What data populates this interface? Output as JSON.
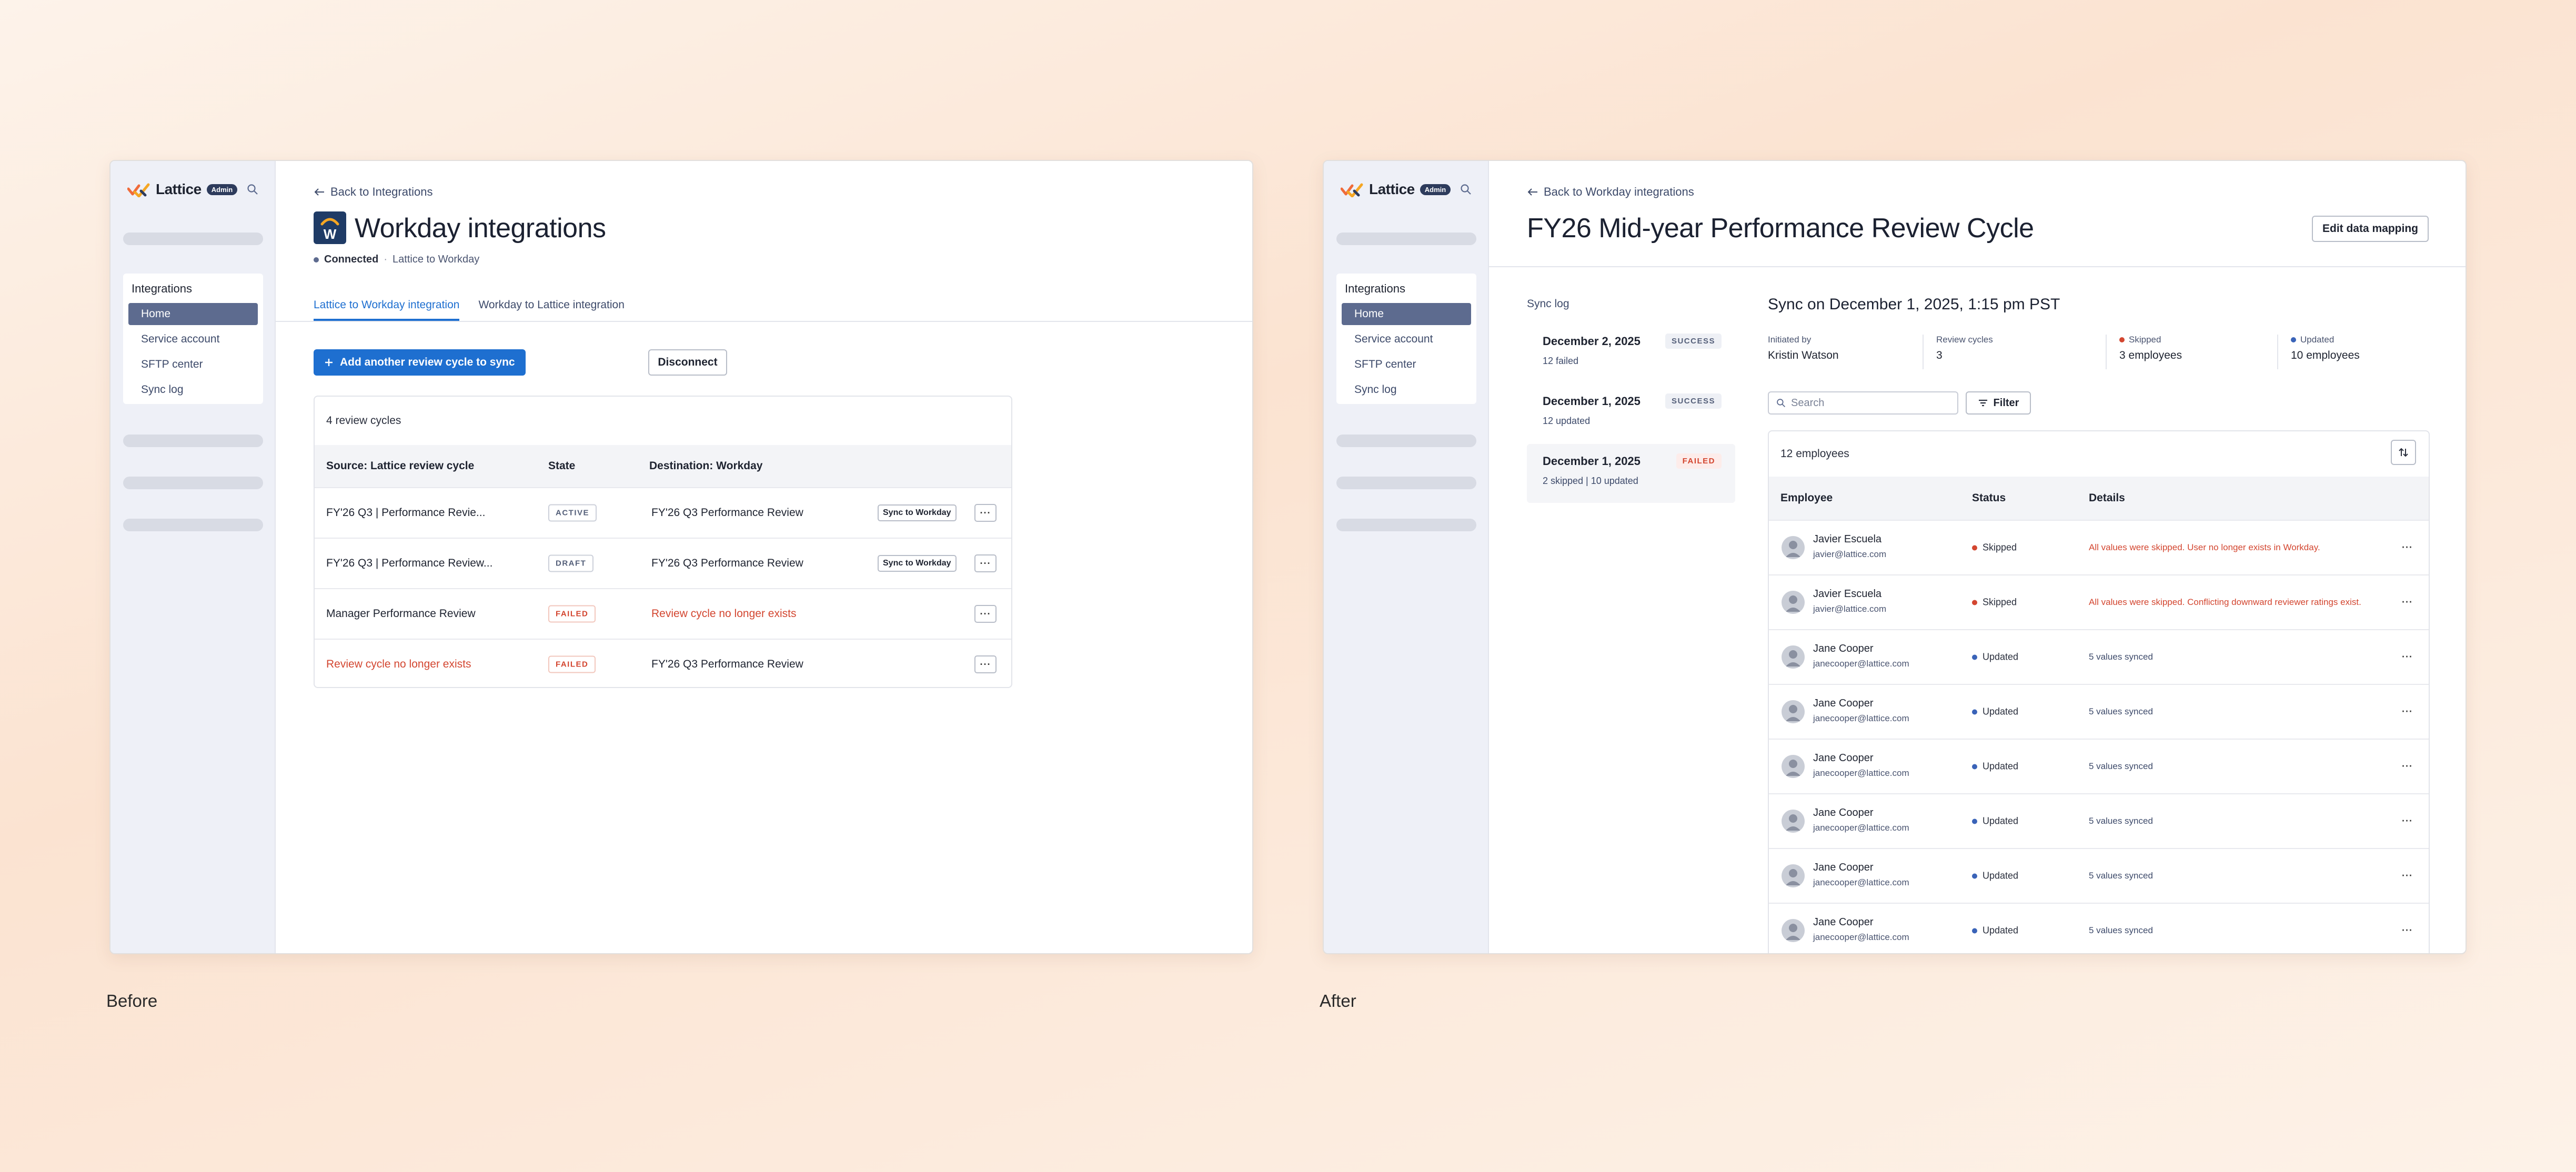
{
  "before": {
    "caption": "Before",
    "app": {
      "name": "Lattice",
      "badge": "Admin"
    },
    "nav": {
      "title": "Integrations",
      "items": [
        "Home",
        "Service account",
        "SFTP center",
        "Sync log"
      ]
    },
    "back_label": "Back to Integrations",
    "page_title": "Workday integrations",
    "status": {
      "label": "Connected",
      "sub": "Lattice to Workday"
    },
    "tabs": [
      "Lattice to Workday integration",
      "Workday to Lattice integration"
    ],
    "add_label": "Add another review cycle to sync",
    "disconnect_label": "Disconnect",
    "card_caption": "4 review cycles",
    "columns": [
      "Source: Lattice review cycle",
      "State",
      "Destination: Workday"
    ],
    "sync_label": "Sync to Workday",
    "rows": [
      {
        "source": "FY'26 Q3 | Performance Revie...",
        "state": "ACTIVE",
        "dest": "FY'26 Q3 Performance Review"
      },
      {
        "source": "FY'26 Q3 | Performance Review...",
        "state": "DRAFT",
        "dest": "FY'26 Q3 Performance Review"
      },
      {
        "source": "Manager Performance Review",
        "state": "FAILED",
        "dest": "Review cycle no longer exists"
      },
      {
        "source": "Review cycle no longer exists",
        "state": "FAILED",
        "dest": "FY'26 Q3 Performance Review"
      }
    ]
  },
  "after": {
    "caption": "After",
    "app": {
      "name": "Lattice",
      "badge": "Admin"
    },
    "nav": {
      "title": "Integrations",
      "items": [
        "Home",
        "Service account",
        "SFTP center",
        "Sync log"
      ]
    },
    "back_label": "Back to Workday integrations",
    "page_title": "FY26 Mid-year Performance Review Cycle",
    "edit_label": "Edit data mapping",
    "sync_log_title": "Sync log",
    "sync_log": [
      {
        "date": "December 2, 2025",
        "badge": "SUCCESS",
        "sub": "12 failed"
      },
      {
        "date": "December 1, 2025",
        "badge": "SUCCESS",
        "sub": "12 updated"
      },
      {
        "date": "December 1, 2025",
        "badge": "FAILED",
        "sub": "2 skipped | 10 updated"
      }
    ],
    "sync_title": "Sync on December 1, 2025, 1:15 pm PST",
    "stats": [
      {
        "label": "Initiated by",
        "value": "Kristin Watson"
      },
      {
        "label": "Review cycles",
        "value": "3"
      },
      {
        "label": "Skipped",
        "value": "3 employees"
      },
      {
        "label": "Updated",
        "value": "10 employees"
      }
    ],
    "search_placeholder": "Search",
    "filter_label": "Filter",
    "emp_count": "12 employees",
    "columns": [
      "Employee",
      "Status",
      "Details"
    ],
    "employees": [
      {
        "name": "Javier Escuela",
        "email": "javier@lattice.com",
        "status": "Skipped",
        "details": "All values were skipped. User no longer exists in Workday."
      },
      {
        "name": "Javier Escuela",
        "email": "javier@lattice.com",
        "status": "Skipped",
        "details": "All values were skipped. Conflicting downward reviewer ratings exist."
      },
      {
        "name": "Jane Cooper",
        "email": "janecooper@lattice.com",
        "status": "Updated",
        "details": "5 values synced"
      },
      {
        "name": "Jane Cooper",
        "email": "janecooper@lattice.com",
        "status": "Updated",
        "details": "5 values synced"
      },
      {
        "name": "Jane Cooper",
        "email": "janecooper@lattice.com",
        "status": "Updated",
        "details": "5 values synced"
      },
      {
        "name": "Jane Cooper",
        "email": "janecooper@lattice.com",
        "status": "Updated",
        "details": "5 values synced"
      },
      {
        "name": "Jane Cooper",
        "email": "janecooper@lattice.com",
        "status": "Updated",
        "details": "5 values synced"
      },
      {
        "name": "Jane Cooper",
        "email": "janecooper@lattice.com",
        "status": "Updated",
        "details": "5 values synced"
      }
    ]
  },
  "colors": {
    "accent": "#1e6fd0",
    "skipped": "#d34630",
    "updated": "#3a63b8",
    "nav_active": "#5d6b8f"
  }
}
